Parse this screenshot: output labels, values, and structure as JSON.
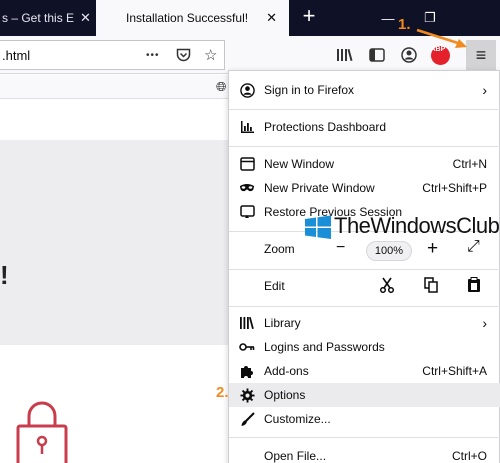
{
  "tabs": [
    {
      "title": "s – Get this E",
      "active": false
    },
    {
      "title": "Installation Successful!",
      "active": true
    }
  ],
  "tab_close_glyph": "✕",
  "new_tab_glyph": "+",
  "window_controls": {
    "minimize": "—",
    "maximize": "❐"
  },
  "urlbar": {
    "text": ".html",
    "more_glyph": "•••"
  },
  "annotations": {
    "step1": "1.",
    "step2": "2."
  },
  "menu": {
    "items": [
      {
        "label": "Sign in to Firefox",
        "icon": "account-icon",
        "submenu": true
      },
      {
        "label": "Protections Dashboard",
        "icon": "chart-icon"
      },
      {
        "label": "New Window",
        "icon": "new-window-icon",
        "shortcut": "Ctrl+N"
      },
      {
        "label": "New Private Window",
        "icon": "mask-icon",
        "shortcut": "Ctrl+Shift+P"
      },
      {
        "label": "Restore Previous Session",
        "icon": "restore-icon"
      },
      {
        "label": "Library",
        "icon": "library-icon",
        "submenu": true
      },
      {
        "label": "Logins and Passwords",
        "icon": "key-icon"
      },
      {
        "label": "Add-ons",
        "icon": "puzzle-icon",
        "shortcut": "Ctrl+Shift+A"
      },
      {
        "label": "Options",
        "icon": "gear-icon"
      },
      {
        "label": "Customize...",
        "icon": "brush-icon"
      },
      {
        "label": "Open File...",
        "icon": "",
        "shortcut": "Ctrl+O"
      }
    ],
    "zoom": {
      "label": "Zoom",
      "value": "100%",
      "minus": "−",
      "plus": "+",
      "fullscreen": "⤢"
    },
    "edit": {
      "label": "Edit"
    }
  },
  "watermark": {
    "text": "TheWindowsClub"
  },
  "page": {
    "exclamation": "!"
  },
  "colors": {
    "accent": "#f18a1f",
    "tabstrip": "#0f1126",
    "highlight": "#ebebed",
    "lock": "#c93c4c"
  }
}
